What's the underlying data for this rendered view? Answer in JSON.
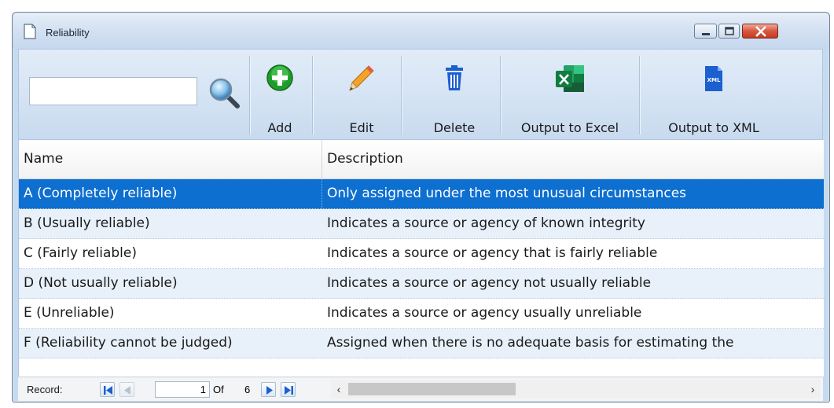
{
  "window": {
    "title": "Reliability"
  },
  "toolbar": {
    "search_value": "",
    "buttons": [
      {
        "label": "Add",
        "icon": "add-icon"
      },
      {
        "label": "Edit",
        "icon": "pencil-icon"
      },
      {
        "label": "Delete",
        "icon": "trash-icon"
      },
      {
        "label": "Output to Excel",
        "icon": "excel-icon"
      },
      {
        "label": "Output to XML",
        "icon": "xml-file-icon"
      }
    ],
    "xml_icon_text": "XML"
  },
  "grid": {
    "columns": [
      "Name",
      "Description"
    ],
    "rows": [
      {
        "name": "A (Completely reliable)",
        "description": "Only assigned under the most unusual circumstances",
        "selected": true
      },
      {
        "name": "B (Usually reliable)",
        "description": "Indicates a source or agency of known integrity"
      },
      {
        "name": "C (Fairly reliable)",
        "description": "Indicates a source or agency that is fairly reliable"
      },
      {
        "name": "D (Not usually reliable)",
        "description": "Indicates a source or agency not usually reliable"
      },
      {
        "name": "E (Unreliable)",
        "description": "Indicates a source or agency usually unreliable"
      },
      {
        "name": "F (Reliability cannot be judged)",
        "description": "Assigned when there is no adequate basis for estimating the"
      }
    ]
  },
  "navigator": {
    "record_label": "Record:",
    "current": "1",
    "of_label": "Of",
    "total": "6"
  },
  "colors": {
    "selection": "#0d6fd0",
    "add_green": "#1f9d2c",
    "excel_green": "#1e7a45",
    "xml_blue": "#1c5fcf",
    "close_red": "#c8432b"
  }
}
